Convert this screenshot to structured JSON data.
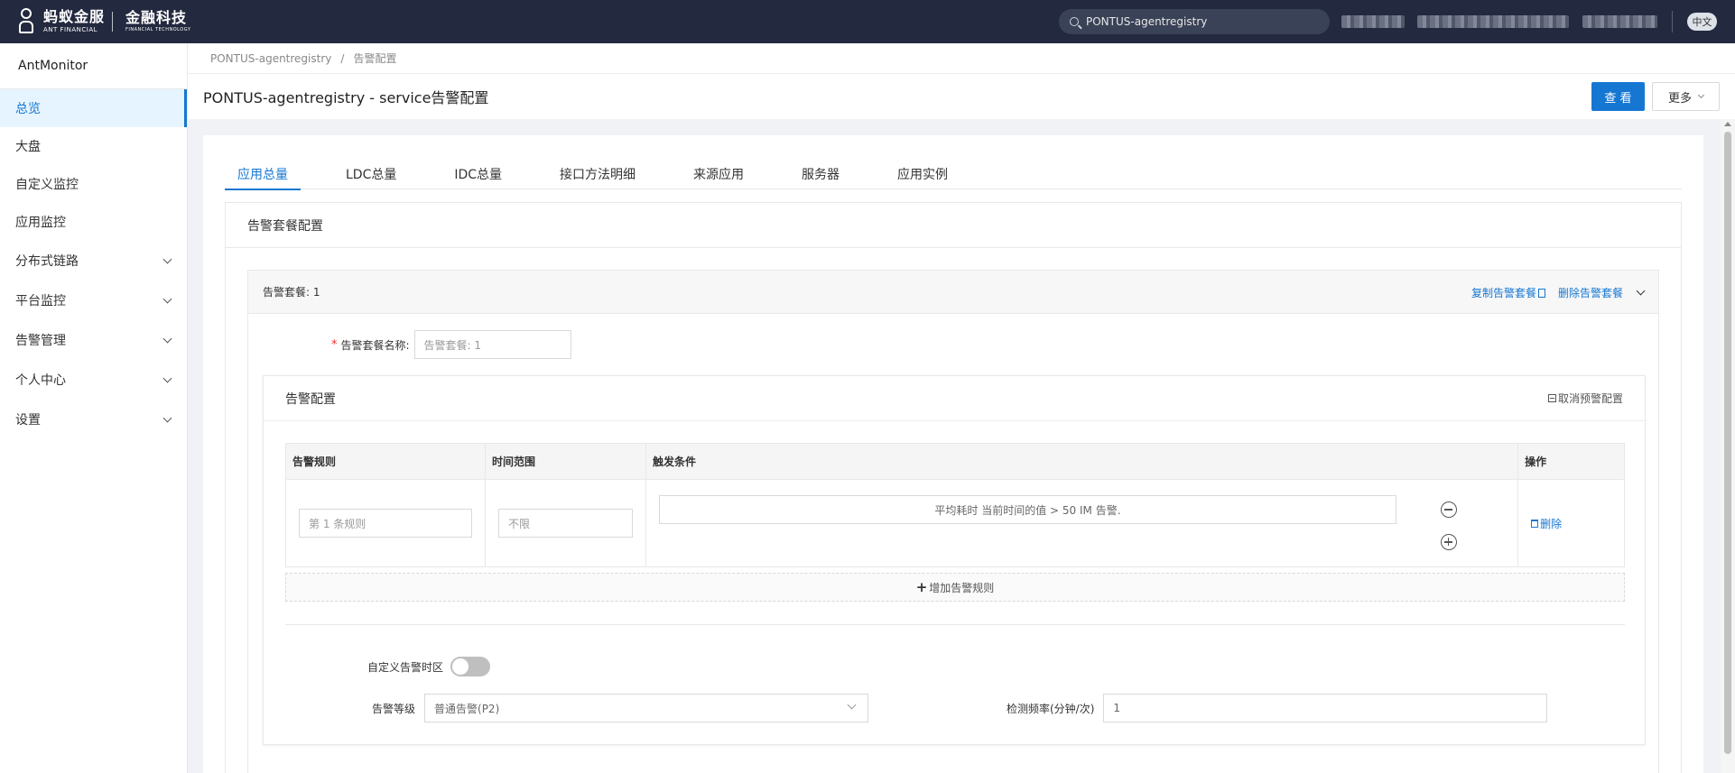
{
  "topbar": {
    "logo_cn": "蚂蚁金服",
    "logo_en": "ANT FINANCIAL",
    "logo2_cn": "金融科技",
    "logo2_en": "FINANCIAL TECHNOLOGY",
    "search_value": "PONTUS-agentregistry",
    "lang": "中文"
  },
  "sidebar": {
    "brand": "AntMonitor",
    "items": [
      {
        "label": "总览",
        "active": true,
        "expandable": false
      },
      {
        "label": "大盘",
        "active": false,
        "expandable": false
      },
      {
        "label": "自定义监控",
        "active": false,
        "expandable": false
      },
      {
        "label": "应用监控",
        "active": false,
        "expandable": false
      },
      {
        "label": "分布式链路",
        "active": false,
        "expandable": true
      },
      {
        "label": "平台监控",
        "active": false,
        "expandable": true
      },
      {
        "label": "告警管理",
        "active": false,
        "expandable": true
      },
      {
        "label": "个人中心",
        "active": false,
        "expandable": true
      },
      {
        "label": "设置",
        "active": false,
        "expandable": true
      }
    ]
  },
  "breadcrumb": [
    "PONTUS-agentregistry",
    "告警配置"
  ],
  "breadcrumb_sep": "/",
  "header": {
    "title": "PONTUS-agentregistry - service告警配置",
    "view_button": "查 看",
    "more_button": "更多"
  },
  "tabs": [
    "应用总量",
    "LDC总量",
    "IDC总量",
    "接口方法明细",
    "来源应用",
    "服务器",
    "应用实例"
  ],
  "panel": {
    "title": "告警套餐配置",
    "package": {
      "title": "告警套餐: 1",
      "copy_link": "复制告警套餐",
      "delete_link": "删除告警套餐",
      "name_label": "告警套餐名称:",
      "name_placeholder": "告警套餐: 1",
      "config": {
        "title": "告警配置",
        "cancel_link": "取消预警配置",
        "columns": [
          "告警规则",
          "时间范围",
          "触发条件",
          "操作"
        ],
        "rows": [
          {
            "rule_placeholder": "第 1 条规则",
            "time_placeholder": "不限",
            "condition": "平均耗时 当前时间的值 > 50 IM 告警.",
            "delete": "删除"
          }
        ],
        "add_rule": "增加告警规则",
        "custom_tz_label": "自定义告警时区",
        "custom_tz_on": false,
        "level_label": "告警等级",
        "level_value": "普通告警(P2)",
        "freq_label": "检测频率(分钟/次)",
        "freq_value": "1"
      }
    }
  },
  "colors": {
    "topbar_bg": "#232a3f",
    "accent": "#1677d2",
    "active_nav_bg": "#e6f4ff"
  }
}
